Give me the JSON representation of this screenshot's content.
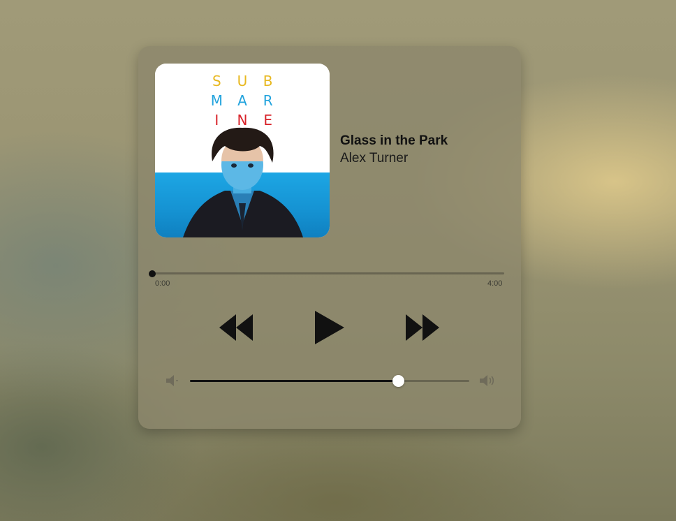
{
  "player": {
    "track_title": "Glass in the Park",
    "artist": "Alex Turner",
    "time_current": "0:00",
    "time_total": "4:00",
    "progress_fraction": 0.0,
    "volume_fraction": 0.745,
    "album_art": {
      "letters": [
        {
          "char": "S",
          "color": "#e8b820"
        },
        {
          "char": "U",
          "color": "#e8b820"
        },
        {
          "char": "B",
          "color": "#e8b820"
        },
        {
          "char": "M",
          "color": "#22a3dd"
        },
        {
          "char": "A",
          "color": "#22a3dd"
        },
        {
          "char": "R",
          "color": "#22a3dd"
        },
        {
          "char": "I",
          "color": "#d8232a"
        },
        {
          "char": "N",
          "color": "#d8232a"
        },
        {
          "char": "E",
          "color": "#d8232a"
        }
      ]
    },
    "icons": {
      "rewind": "rewind-icon",
      "play": "play-icon",
      "fast_forward": "fast-forward-icon",
      "volume_low": "volume-mute-icon",
      "volume_high": "volume-high-icon"
    }
  }
}
